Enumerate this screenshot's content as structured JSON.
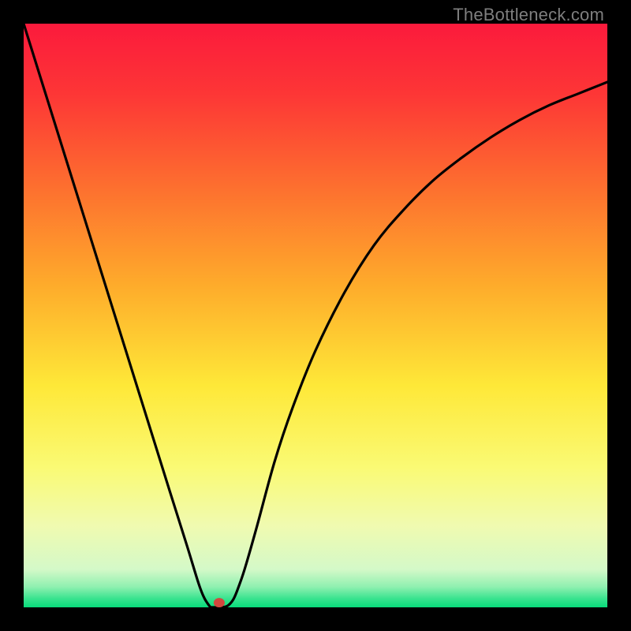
{
  "watermark": {
    "text": "TheBottleneck.com"
  },
  "chart_data": {
    "type": "line",
    "title": "",
    "xlabel": "",
    "ylabel": "",
    "xlim": [
      0,
      100
    ],
    "ylim": [
      0,
      100
    ],
    "gradient_stops": [
      {
        "offset": 0.0,
        "color": "#fb1a3c"
      },
      {
        "offset": 0.12,
        "color": "#fd3636"
      },
      {
        "offset": 0.28,
        "color": "#fd6f2f"
      },
      {
        "offset": 0.45,
        "color": "#feac2b"
      },
      {
        "offset": 0.62,
        "color": "#fee838"
      },
      {
        "offset": 0.76,
        "color": "#fafa74"
      },
      {
        "offset": 0.86,
        "color": "#f0fab0"
      },
      {
        "offset": 0.935,
        "color": "#d4f9c8"
      },
      {
        "offset": 0.965,
        "color": "#8ff0b0"
      },
      {
        "offset": 0.985,
        "color": "#39e38f"
      },
      {
        "offset": 1.0,
        "color": "#08db7a"
      }
    ],
    "series": [
      {
        "name": "bottleneck-curve",
        "x": [
          0,
          5,
          10,
          15,
          20,
          25,
          28,
          30,
          31,
          32,
          33,
          34,
          35,
          36,
          37,
          38,
          40,
          43,
          46,
          50,
          55,
          60,
          65,
          70,
          75,
          80,
          85,
          90,
          95,
          100
        ],
        "values": [
          100,
          84,
          68,
          52,
          36,
          20,
          10.5,
          4,
          1.5,
          0.5,
          0,
          0,
          0.3,
          1.5,
          4,
          7,
          14,
          25,
          34,
          44,
          54,
          62,
          68,
          73,
          77,
          80.5,
          83.5,
          86,
          88,
          90
        ]
      }
    ],
    "marker": {
      "x": 33.5,
      "y": 0.8,
      "color": "#d1473e"
    },
    "min_plateau": {
      "x_start": 32,
      "x_end": 34,
      "y": 0
    }
  }
}
